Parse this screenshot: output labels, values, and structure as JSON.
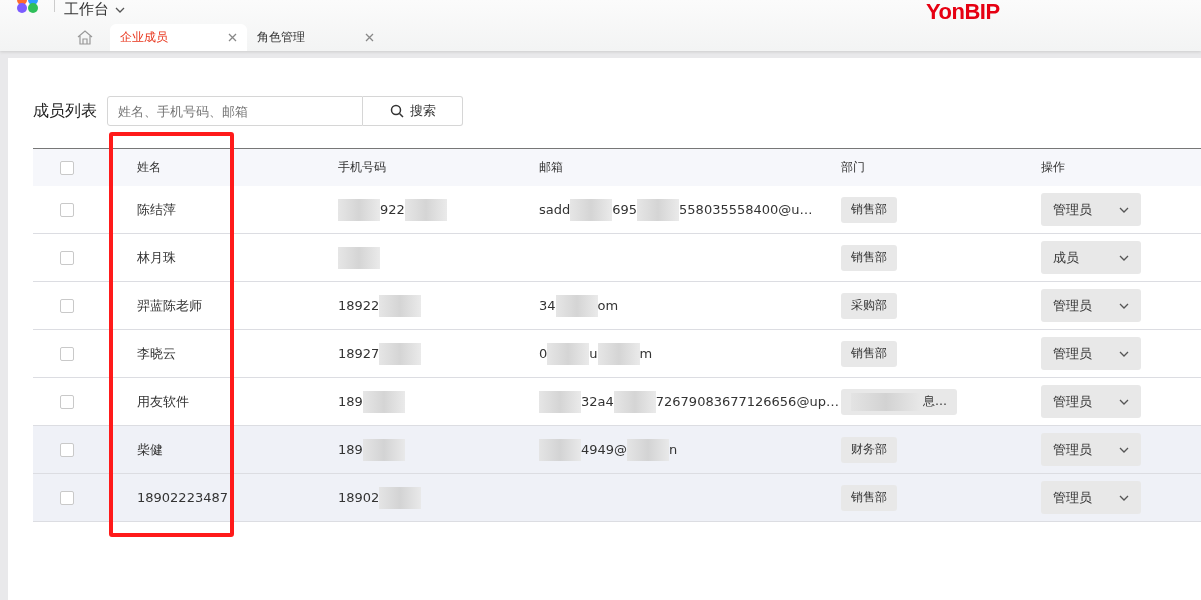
{
  "header": {
    "workspace": "工作台",
    "brand": "YonBIP"
  },
  "tabs": [
    {
      "label": "企业成员",
      "selected": true
    },
    {
      "label": "角色管理",
      "selected": false
    }
  ],
  "list_title": "成员列表",
  "search": {
    "placeholder": "姓名、手机号码、邮箱",
    "button": "搜索"
  },
  "table": {
    "columns": [
      "姓名",
      "手机号码",
      "邮箱",
      "部门",
      "操作"
    ],
    "all_checked": false,
    "rows": [
      {
        "checked": false,
        "shaded": false,
        "name": "陈结萍",
        "phone": [
          {
            "kind": "blur"
          },
          {
            "kind": "text",
            "text": "922"
          },
          {
            "kind": "blur"
          }
        ],
        "email": [
          {
            "kind": "text",
            "text": "sadd"
          },
          {
            "kind": "blur"
          },
          {
            "kind": "text",
            "text": "695"
          },
          {
            "kind": "blur"
          },
          {
            "kind": "text",
            "text": "558035558400@u…"
          }
        ],
        "dept": [
          {
            "kind": "text",
            "text": "销售部"
          }
        ],
        "role": "管理员"
      },
      {
        "checked": false,
        "shaded": false,
        "name": "林月珠",
        "phone": [
          {
            "kind": "blur"
          }
        ],
        "email": [],
        "dept": [
          {
            "kind": "text",
            "text": "销售部"
          }
        ],
        "role": "成员"
      },
      {
        "checked": false,
        "shaded": false,
        "name": "羿蓝陈老师",
        "phone": [
          {
            "kind": "text",
            "text": "18922"
          },
          {
            "kind": "blur"
          }
        ],
        "email": [
          {
            "kind": "text",
            "text": "34"
          },
          {
            "kind": "blur"
          },
          {
            "kind": "text",
            "text": "om"
          }
        ],
        "dept": [
          {
            "kind": "text",
            "text": "采购部"
          }
        ],
        "role": "管理员"
      },
      {
        "checked": false,
        "shaded": false,
        "name": "李晓云",
        "phone": [
          {
            "kind": "text",
            "text": "18927"
          },
          {
            "kind": "blur"
          }
        ],
        "email": [
          {
            "kind": "text",
            "text": "0"
          },
          {
            "kind": "blur"
          },
          {
            "kind": "text",
            "text": "u"
          },
          {
            "kind": "blur"
          },
          {
            "kind": "text",
            "text": "m"
          }
        ],
        "dept": [
          {
            "kind": "text",
            "text": "销售部"
          }
        ],
        "role": "管理员"
      },
      {
        "checked": false,
        "shaded": false,
        "name": "用友软件",
        "phone": [
          {
            "kind": "text",
            "text": "189"
          },
          {
            "kind": "blur"
          }
        ],
        "email": [
          {
            "kind": "blur"
          },
          {
            "kind": "text",
            "text": "32a4"
          },
          {
            "kind": "blur"
          },
          {
            "kind": "text",
            "text": "72679083677126656@up…"
          }
        ],
        "dept": [
          {
            "kind": "blur"
          },
          {
            "kind": "text",
            "text": "息…"
          }
        ],
        "role": "管理员"
      },
      {
        "checked": false,
        "shaded": true,
        "name": "柴健",
        "phone": [
          {
            "kind": "text",
            "text": "189"
          },
          {
            "kind": "blur"
          }
        ],
        "email": [
          {
            "kind": "blur"
          },
          {
            "kind": "text",
            "text": "4949@"
          },
          {
            "kind": "blur"
          },
          {
            "kind": "text",
            "text": "n"
          }
        ],
        "dept": [
          {
            "kind": "text",
            "text": "财务部"
          }
        ],
        "role": "管理员"
      },
      {
        "checked": false,
        "shaded": true,
        "name": "18902223487",
        "phone": [
          {
            "kind": "text",
            "text": "18902"
          },
          {
            "kind": "blur"
          }
        ],
        "email": [],
        "dept": [
          {
            "kind": "text",
            "text": "销售部"
          }
        ],
        "role": "管理员"
      }
    ]
  }
}
